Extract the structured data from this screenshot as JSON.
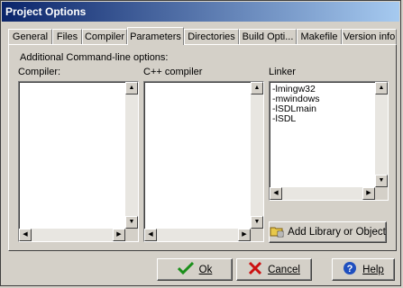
{
  "window": {
    "title": "Project Options"
  },
  "tabs": [
    {
      "label": "General"
    },
    {
      "label": "Files"
    },
    {
      "label": "Compiler"
    },
    {
      "label": "Parameters",
      "active": true
    },
    {
      "label": "Directories"
    },
    {
      "label": "Build Opti..."
    },
    {
      "label": "Makefile"
    },
    {
      "label": "Version info"
    }
  ],
  "panel": {
    "heading": "Additional Command-line options:",
    "compiler_label": "Compiler:",
    "cpp_label": "C++ compiler",
    "linker_label": "Linker",
    "linker_items": [
      "-lmingw32",
      "-mwindows",
      "-lSDLmain",
      "-lSDL"
    ],
    "add_library_label": "Add Library or Object"
  },
  "buttons": {
    "ok_label": "Ok",
    "cancel_label": "Cancel",
    "help_label": "Help"
  },
  "icons": {
    "ok": "check-icon",
    "cancel": "cross-icon",
    "help": "question-icon",
    "add_library": "folder-add-icon"
  },
  "colors": {
    "titlebar_start": "#0a246a",
    "titlebar_end": "#a6caf0",
    "face": "#d4d0c8",
    "ok_check": "#1a8f1a",
    "cancel_x": "#cc1010",
    "help_blue": "#1f4fbf"
  }
}
